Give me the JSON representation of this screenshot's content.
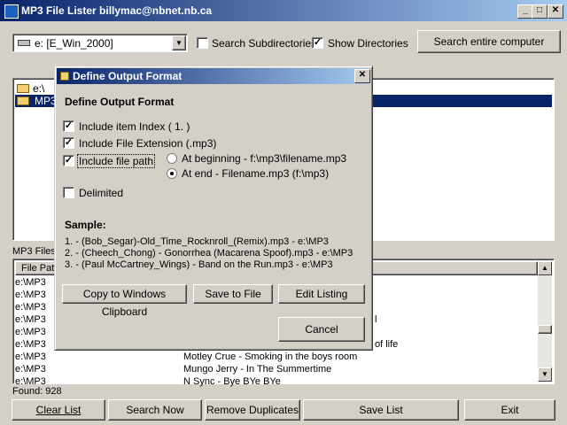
{
  "window": {
    "title": "MP3 File Lister billymac@nbnet.nb.ca"
  },
  "toolbar": {
    "drive_value": "e: [E_Win_2000]",
    "search_subdirs_label": "Search Subdirectories",
    "search_subdirs_checked": false,
    "show_dirs_label": "Show Directories",
    "show_dirs_checked": true,
    "search_computer_label": "Search entire computer"
  },
  "tree": {
    "items": [
      "e:\\",
      "MP3"
    ]
  },
  "files_section": {
    "label": "MP3 Files",
    "col_path": "File Path",
    "rows": [
      {
        "path": "e:\\MP3",
        "name": ""
      },
      {
        "path": "e:\\MP3",
        "name": ""
      },
      {
        "path": "e:\\MP3",
        "name": ""
      },
      {
        "path": "e:\\MP3",
        "name": "l"
      },
      {
        "path": "e:\\MP3",
        "name": ""
      },
      {
        "path": "e:\\MP3",
        "name": "of life"
      },
      {
        "path": "e:\\MP3",
        "name": "Motley Crue -  Smoking in the boys room"
      },
      {
        "path": "e:\\MP3",
        "name": "Mungo Jerry - In The Summertime"
      },
      {
        "path": "e:\\MP3",
        "name": "N Sync - Bye BYe BYe"
      }
    ]
  },
  "status": {
    "found": "Found: 928"
  },
  "bottom_buttons": {
    "clear": "Clear List",
    "search": "Search Now",
    "remove": "Remove Duplicates",
    "save": "Save List",
    "exit": "Exit"
  },
  "dialog": {
    "title": "Define Output Format",
    "heading": "Define Output Format",
    "opt_index": "Include item Index ( 1. )",
    "opt_ext": "Include File Extension (.mp3)",
    "opt_path": "Include file path",
    "radio_begin": "At beginning - f:\\mp3\\filename.mp3",
    "radio_end": "At end - Filename.mp3 (f:\\mp3)",
    "opt_delim": "Delimited",
    "sample_heading": "Sample:",
    "samples": [
      "1. - (Bob_Segar)-Old_Time_Rocknroll_(Remix).mp3 - e:\\MP3",
      "2. - (Cheech_Chong) - Gonorrhea (Macarena Spoof).mp3 - e:\\MP3",
      "3. - (Paul McCartney_Wings) - Band on the Run.mp3 - e:\\MP3"
    ],
    "btn_copy": "Copy to Windows Clipboard",
    "btn_savefile": "Save to File",
    "btn_edit": "Edit Listing",
    "btn_cancel": "Cancel"
  },
  "colors": {
    "face": "#d4d0c8",
    "title_active": "#0a246a",
    "selection": "#0a246a"
  }
}
